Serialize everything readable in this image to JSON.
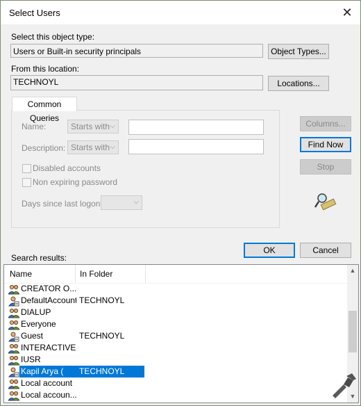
{
  "dialog": {
    "title": "Select Users",
    "close_label": "✕"
  },
  "object_type": {
    "label": "Select this object type:",
    "value": "Users or Built-in security principals",
    "button": "Object Types..."
  },
  "location": {
    "label": "From this location:",
    "value": "TECHNOYL",
    "button": "Locations..."
  },
  "queries": {
    "tab_label": "Common Queries",
    "name_label": "Name:",
    "name_mode": "Starts with",
    "name_value": "",
    "description_label": "Description:",
    "description_mode": "Starts with",
    "description_value": "",
    "disabled_accounts_label": "Disabled accounts",
    "disabled_accounts_checked": false,
    "non_expiring_label": "Non expiring password",
    "non_expiring_checked": false,
    "days_label": "Days since last logon:",
    "days_value": ""
  },
  "side_buttons": {
    "columns": "Columns...",
    "find_now": "Find Now",
    "stop": "Stop"
  },
  "dialog_buttons": {
    "ok": "OK",
    "cancel": "Cancel"
  },
  "search_results": {
    "label": "Search results:",
    "columns": [
      "Name",
      "In Folder"
    ],
    "rows": [
      {
        "name": "CREATOR O...",
        "folder": "",
        "icon": "group-icon",
        "selected": false
      },
      {
        "name": "DefaultAccount",
        "folder": "TECHNOYL",
        "icon": "user-icon",
        "selected": false
      },
      {
        "name": "DIALUP",
        "folder": "",
        "icon": "group-icon",
        "selected": false
      },
      {
        "name": "Everyone",
        "folder": "",
        "icon": "group-icon",
        "selected": false
      },
      {
        "name": "Guest",
        "folder": "TECHNOYL",
        "icon": "user-icon",
        "selected": false
      },
      {
        "name": "INTERACTIVE",
        "folder": "",
        "icon": "group-icon",
        "selected": false
      },
      {
        "name": "IUSR",
        "folder": "",
        "icon": "group-icon",
        "selected": false
      },
      {
        "name": "Kapil Arya (",
        "folder": "TECHNOYL",
        "icon": "user-icon",
        "selected": true
      },
      {
        "name": "Local account",
        "folder": "",
        "icon": "group-icon",
        "selected": false
      },
      {
        "name": "Local accoun...",
        "folder": "",
        "icon": "group-icon",
        "selected": false
      }
    ]
  },
  "colors": {
    "selection": "#0078d7",
    "window_bg": "#f0f0f0"
  }
}
